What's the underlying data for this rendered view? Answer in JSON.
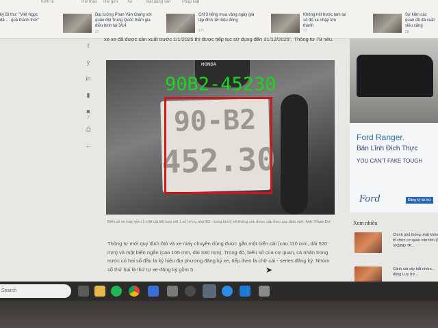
{
  "top_strip": {
    "category_labels": [
      "Kinh tế",
      "Thể thao",
      "Thế giới",
      "Xe",
      "Bất động sản",
      "Pháp luật"
    ],
    "items": [
      {
        "title": "ký Bí thư: \"Việt Ngọc đã … quả thành thời\"",
        "meta": ""
      },
      {
        "title": "Đại tướng Phan Văn Giang với quân đội Trung Quốc thăm gia diễu binh tại 3/14",
        "meta": "27"
      },
      {
        "title": "Chỉ 3 tiếng mua vàng ngày giá lập đỉnh 18 triệu đồng",
        "meta": "172"
      },
      {
        "title": "Không hết bước lam lại số độ xa nhập lớn thành",
        "meta": "72"
      },
      {
        "title": "Sự kiện các quan đề đã xuất siêu căng",
        "meta": "39"
      }
    ]
  },
  "share_icons": [
    "facebook-icon",
    "twitter-icon",
    "linkedin-icon",
    "bookmark-icon",
    "comment-icon",
    "comment-count",
    "print-icon",
    "back-icon"
  ],
  "share_labels": [
    "f",
    "y",
    "in",
    "▮",
    "■",
    "7",
    "⎙",
    "←"
  ],
  "article": {
    "intro": "xe xe đã được sản xuất trước 1/1/2025 thì được tiếp tục sử dụng đến 31/12/2025\", Thông tư 79 nêu.",
    "detection_label": "90B2-45230",
    "plate_line1": "90-B2",
    "plate_line2": "452.30",
    "plate_brand": "HONDA",
    "caption": "Biển số xe máy gồm 1 chữ cái kết hợp với 1 số (ví dụ như B2 - trong hình) số không còn được cấp theo quy định mới. Ảnh: Phạm Dư",
    "body": "Thông tư mới quy định ôtô và xe máy chuyên dùng được gắn một biển dài (cao 110 mm, dài 520 mm) và một biển ngắn (cao 165 mm, dài 330 mm). Trong đó, biển số của cơ quan, cá nhân trong nước có hai số đầu là ký hiệu địa phương đăng ký xe, tiếp theo là chữ cái - series đăng ký. Nhóm số thứ hai là thứ tự xe đăng ký gồm 5"
  },
  "ad": {
    "title": "Ford Ranger.",
    "subtitle": "Bản Lĩnh Đích Thực",
    "tagline": "YOU CAN'T FAKE TOUGH",
    "logo": "Ford",
    "cta": "Đăng ký lái thử"
  },
  "sidebar": {
    "heading": "Xem nhiều",
    "items": [
      {
        "title": "Chính phủ thống nhất không tổ chức cơ quan cấp tỉnh (ở VKSND TP..."
      },
      {
        "title": "Cảnh sát vây bắt nhóm... đồng Lưu trữ..."
      }
    ]
  },
  "taskbar": {
    "search_placeholder": "Search",
    "apps": [
      "file-explorer-icon",
      "folder-icon",
      "spotify-icon",
      "chrome-icon",
      "mail-icon",
      "store-icon",
      "refresh-icon",
      "chrome-active-icon",
      "messenger-icon",
      "vscode-icon",
      "app-icon"
    ]
  },
  "colors": {
    "detection_box": "#d0151c",
    "detection_text": "#16d81c",
    "ad_blue": "#2a6fb0"
  }
}
